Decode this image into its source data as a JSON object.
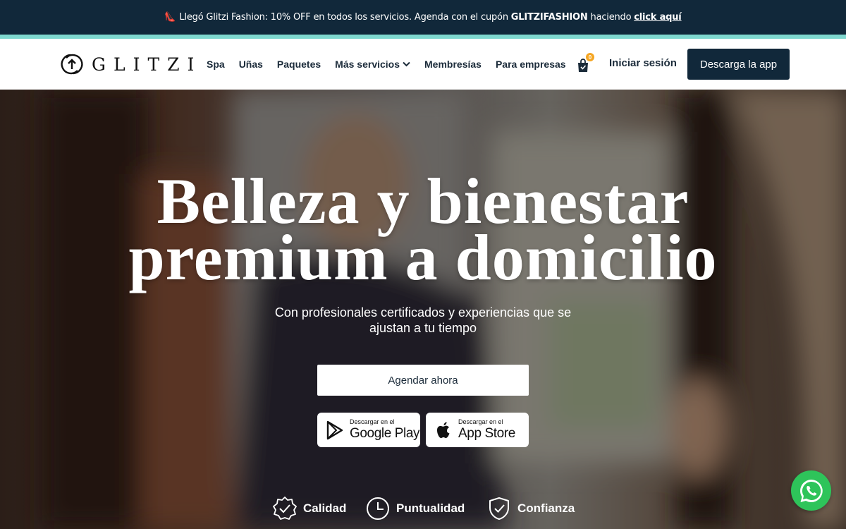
{
  "announcement": {
    "text_before": "Llegó Glitzi Fashion: 10% OFF en todos los servicios. Agenda con el cupón",
    "coupon": "GLITZIFASHION",
    "text_after": "haciendo",
    "link": "click aquí",
    "icon": "high-heel-icon"
  },
  "header": {
    "logo_text": "GLITZI",
    "nav": [
      "Spa",
      "Uñas",
      "Paquetes",
      "Más servicios",
      "Membresías",
      "Para empresas"
    ],
    "cart_count": "0",
    "login": "Iniciar sesión",
    "download": "Descarga la app"
  },
  "hero": {
    "title_line1": "Belleza y bienestar",
    "title_line2": "premium a domicilio",
    "subtitle_line1": "Con profesionales certificados y experiencias que se",
    "subtitle_line2": "ajustan a tu tiempo",
    "cta": "Agendar ahora",
    "google_small": "Descargar en el",
    "google_big": "Google Play",
    "apple_small": "Descargar en el",
    "apple_big": "App Store"
  },
  "features": [
    "Calidad",
    "Puntualidad",
    "Confianza"
  ],
  "colors": {
    "navy": "#11283a",
    "teal": "#7fd8cf",
    "badge": "#f5a623",
    "whatsapp": "#2ec45a"
  }
}
